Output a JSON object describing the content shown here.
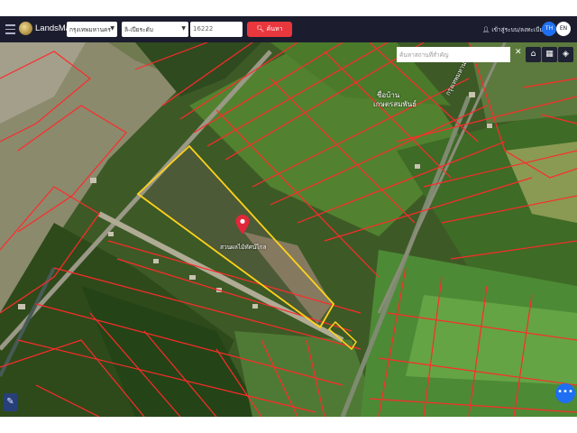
{
  "app": {
    "brand": "LandsMaps"
  },
  "navbar": {
    "province": "กรุงเทพมหานคร",
    "district": "ลิ-เปียระดับ",
    "parcel_number": "16222",
    "search_label": "ค้นหา",
    "login_label": "เข้าสู่ระบบ/ลงทะเบียน",
    "lang_th": "TH",
    "lang_en": "EN"
  },
  "map": {
    "search_placeholder": "ค้นหาสถานที่สำคัญ",
    "place_label": "สวนผลไม้ทัศน์ไกล",
    "area_labels": [
      "ชื่อบ้าน",
      "เกษตรสมพันธ์"
    ],
    "road_label": "กรุงเทพมหานคร",
    "fab_label": "•••"
  },
  "colors": {
    "navbar": "#1b1d2e",
    "search_button": "#e8373d",
    "lang_active": "#1e6ff2",
    "parcel_outline": "#ff2a2a",
    "selected_parcel": "#ffd21a",
    "pin": "#e0283a"
  },
  "icons": [
    "menu-icon",
    "logo-icon",
    "search-icon",
    "user-icon",
    "close-icon",
    "home-icon",
    "grid-icon",
    "layers-icon",
    "tool-icon",
    "more-icon",
    "map-pin-icon"
  ]
}
